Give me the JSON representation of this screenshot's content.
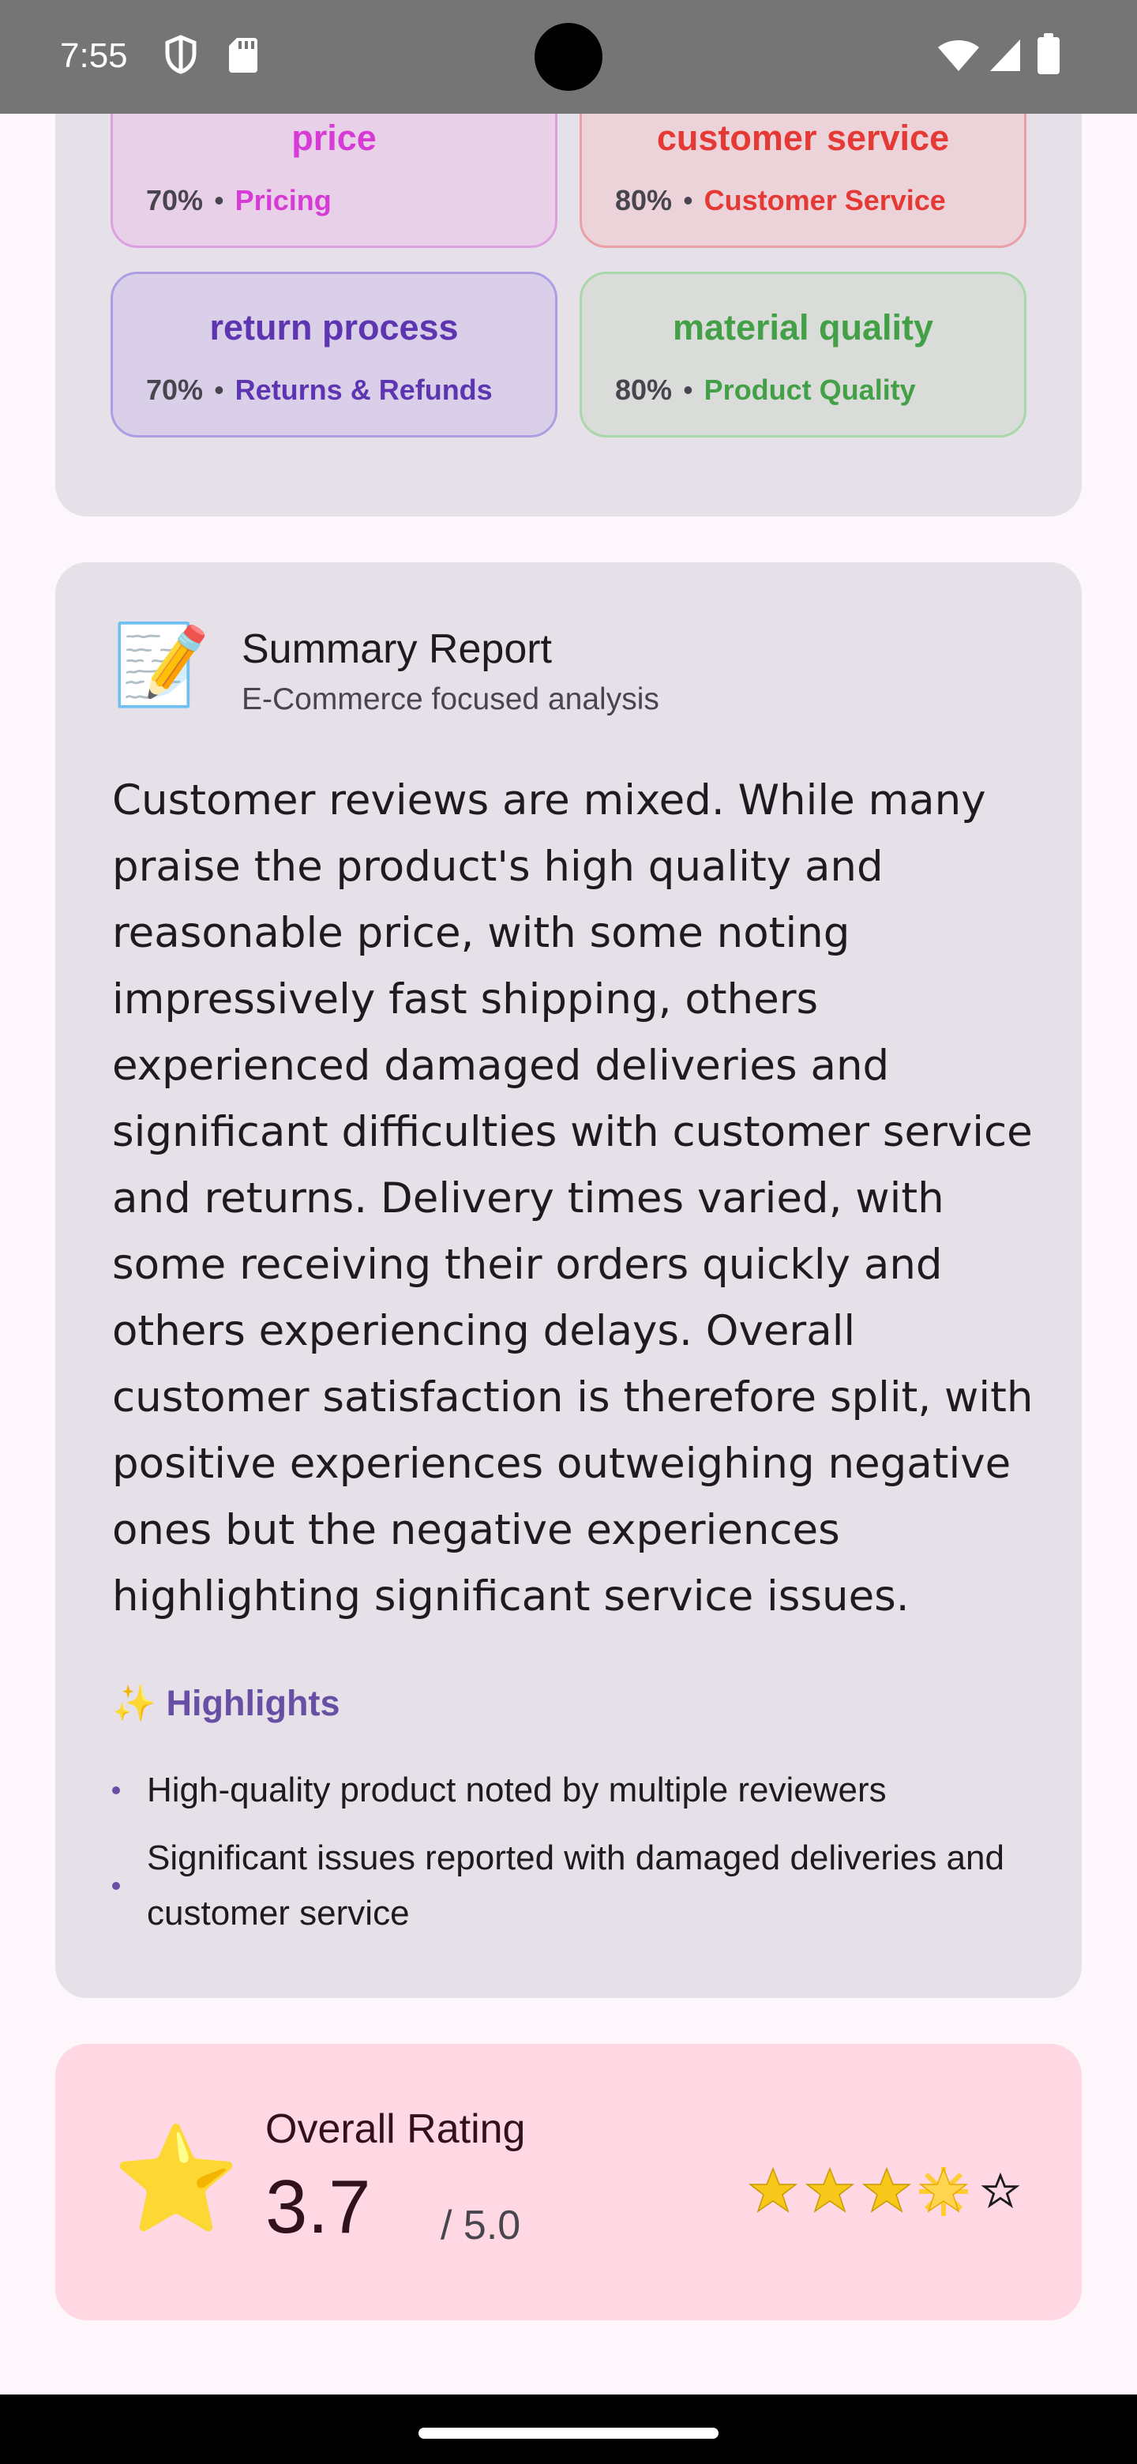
{
  "status_bar": {
    "time": "7:55",
    "left_icons": [
      "shield-icon",
      "sd-card-icon"
    ],
    "right_icons": [
      "wifi-icon",
      "cellular-signal-icon",
      "battery-icon"
    ]
  },
  "aspects": {
    "items": [
      {
        "title": "price",
        "percent": "70%",
        "category": "Pricing",
        "color": "#d63bd6",
        "bg": "#e8d0e8",
        "border": "#dca0de"
      },
      {
        "title": "customer service",
        "percent": "80%",
        "category": "Customer Service",
        "color": "#e53935",
        "bg": "#ecd3d9",
        "border": "#eb9fa6"
      },
      {
        "title": "return process",
        "percent": "70%",
        "category": "Returns & Refunds",
        "color": "#5e35b1",
        "bg": "#d9cfe8",
        "border": "#ae9de3"
      },
      {
        "title": "material quality",
        "percent": "80%",
        "category": "Product Quality",
        "color": "#43a047",
        "bg": "#dadcda",
        "border": "#a8d8aa"
      }
    ],
    "separator": "•"
  },
  "summary": {
    "emoji": "📝",
    "title": "Summary Report",
    "subtitle": "E-Commerce focused analysis",
    "body": "Customer reviews are mixed.  While many praise the product's high quality and reasonable price, with some noting impressively fast shipping, others experienced damaged deliveries and significant difficulties with customer service and returns. Delivery times varied, with some receiving their orders quickly and others experiencing delays. Overall customer satisfaction is therefore split, with positive experiences outweighing negative ones but the negative experiences highlighting significant service issues.",
    "highlights_title": "✨ Highlights",
    "highlights": [
      "High-quality product noted by multiple reviewers",
      "Significant issues reported with damaged deliveries and customer service"
    ]
  },
  "rating": {
    "icon": "⭐",
    "title": "Overall Rating",
    "value": "3.7",
    "max": "/ 5.0",
    "score": 3.7,
    "out_of": 5,
    "star_color": "#f7c71b"
  }
}
